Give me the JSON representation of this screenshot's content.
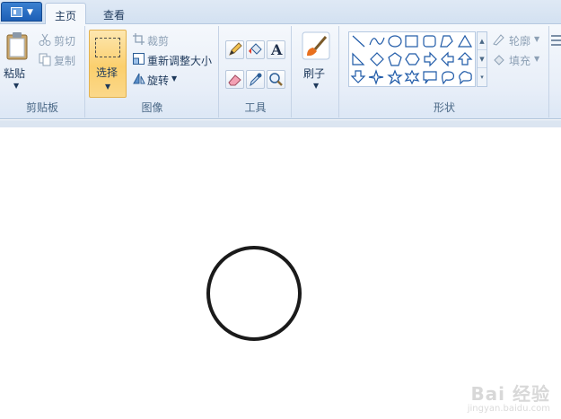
{
  "tabs": {
    "home": "主页",
    "view": "查看"
  },
  "clipboard": {
    "paste": "粘贴",
    "cut": "剪切",
    "copy": "复制",
    "group": "剪贴板"
  },
  "image": {
    "select": "选择",
    "crop": "裁剪",
    "resize": "重新调整大小",
    "rotate": "旋转",
    "group": "图像"
  },
  "tools": {
    "group": "工具",
    "text_glyph": "A"
  },
  "brush": {
    "label": "刷子"
  },
  "shapes": {
    "group": "形状",
    "outline": "轮廓",
    "fill": "填充"
  },
  "watermark": {
    "brand": "Bai 经验",
    "url": "jingyan.baidu.com"
  },
  "colors": {
    "accent": "#fbcf6d",
    "ribbon_bg": "#e7eef8",
    "shape_stroke": "#1f5aa8",
    "circle_stroke": "#1a1a1a"
  }
}
